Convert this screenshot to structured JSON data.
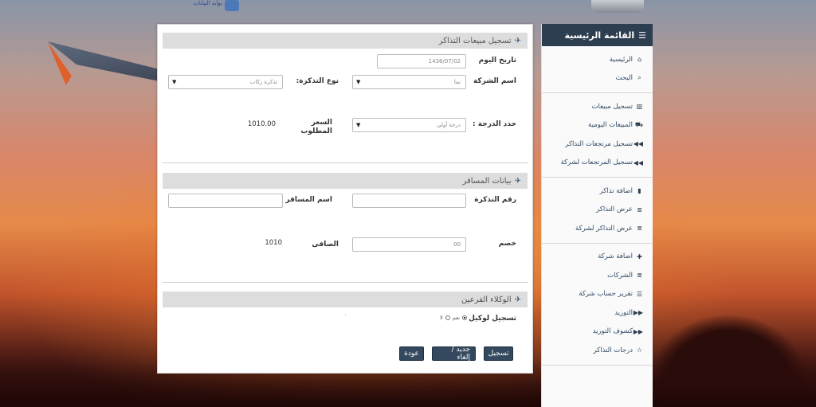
{
  "background": {
    "accent": "#2c3e50"
  },
  "sidebar": {
    "title": "القائمة الرئيسية",
    "groups": [
      [
        {
          "label": "الرئيسية",
          "icon": "home-icon"
        },
        {
          "label": "البحث",
          "icon": "search-icon"
        }
      ],
      [
        {
          "label": "تسجيل مبيعات",
          "icon": "book-icon"
        },
        {
          "label": "المبيعات اليومية",
          "icon": "cart-icon"
        },
        {
          "label": "تسجيل مرتجعات التذاكر",
          "icon": "backward-icon"
        },
        {
          "label": "تسجيل المرتجعات لشركة",
          "icon": "backward-icon"
        }
      ],
      [
        {
          "label": "اضافة تذاكر",
          "icon": "file-icon"
        },
        {
          "label": "عرض التذاكر",
          "icon": "list-icon"
        },
        {
          "label": "عرض التذاكر لشركة",
          "icon": "list-icon"
        }
      ],
      [
        {
          "label": "اضافة شركة",
          "icon": "plus-icon"
        },
        {
          "label": "الشركات",
          "icon": "list-icon"
        },
        {
          "label": "تقرير حساب شركة",
          "icon": "report-icon"
        },
        {
          "label": "التوريد",
          "icon": "forward-icon"
        },
        {
          "label": "كشوف التوريد",
          "icon": "forward-icon"
        },
        {
          "label": "درجات التذاكر",
          "icon": "star-icon"
        }
      ]
    ]
  },
  "form": {
    "section1_title": "تسجيل مبيعات التذاكر",
    "date_label": "تاريخ اليوم",
    "date_value": "1436/07/02",
    "company_label": "اسم الشركة",
    "company_value": "نما",
    "ticket_type_label": "نوع التذكرة:",
    "ticket_type_value": "تذكرة ركاب",
    "class_label": "حدد الدرجة :",
    "class_value": "درجة أولى",
    "price_label": "السعر المطلوب",
    "price_value": "1010.00",
    "section2_title": "بيانات المسافر",
    "ticket_no_label": "رقم التذكرة",
    "ticket_no_value": "",
    "passenger_label": "اسم المسافر",
    "passenger_value": "",
    "discount_label": "خصم",
    "discount_value": "00",
    "net_label": "الصافى",
    "net_value": "1010",
    "section3_title": "الوكلاء الفرعين",
    "agent_label": "تسجيل لوكيل",
    "radio_yes": "نعم",
    "radio_no": "لا",
    "dot": "."
  },
  "buttons": {
    "save": "تسجيل",
    "new_cancel": "جديد / إلغاء",
    "back": "عودة"
  },
  "top_logo_text": "بوابة البيانات"
}
